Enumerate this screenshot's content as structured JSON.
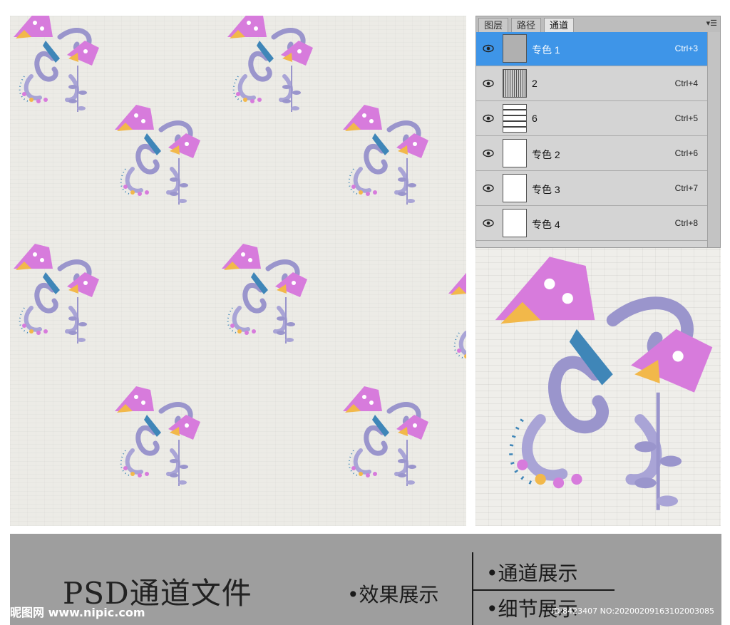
{
  "panel": {
    "tabs": [
      "图层",
      "路径",
      "通道"
    ],
    "active_tab": "通道",
    "menu_icon": "panel-menu-icon",
    "channels": [
      {
        "label": "专色 1",
        "shortcut": "Ctrl+3",
        "selected": true
      },
      {
        "label": "2",
        "shortcut": "Ctrl+4",
        "selected": false
      },
      {
        "label": "6",
        "shortcut": "Ctrl+5",
        "selected": false
      },
      {
        "label": "专色 2",
        "shortcut": "Ctrl+6",
        "selected": false
      },
      {
        "label": "专色 3",
        "shortcut": "Ctrl+7",
        "selected": false
      },
      {
        "label": "专色 4",
        "shortcut": "Ctrl+8",
        "selected": false
      }
    ]
  },
  "banner": {
    "title": "PSD通道文件",
    "effect": "•效果展示",
    "channels": "•通道展示",
    "detail": "•细节展示",
    "logo": "昵图网 www.nipic.com",
    "id_text": "ID:8423407 NO:20200209163102003085"
  },
  "colors": {
    "accent_selected": "#3e95e8",
    "banner_bg": "#9e9e9e",
    "petal_pink": "#d77bdc",
    "petal_yellow": "#f2b84a",
    "leaf_lavender": "#9a95cc",
    "stem_teal": "#3f86b8"
  }
}
